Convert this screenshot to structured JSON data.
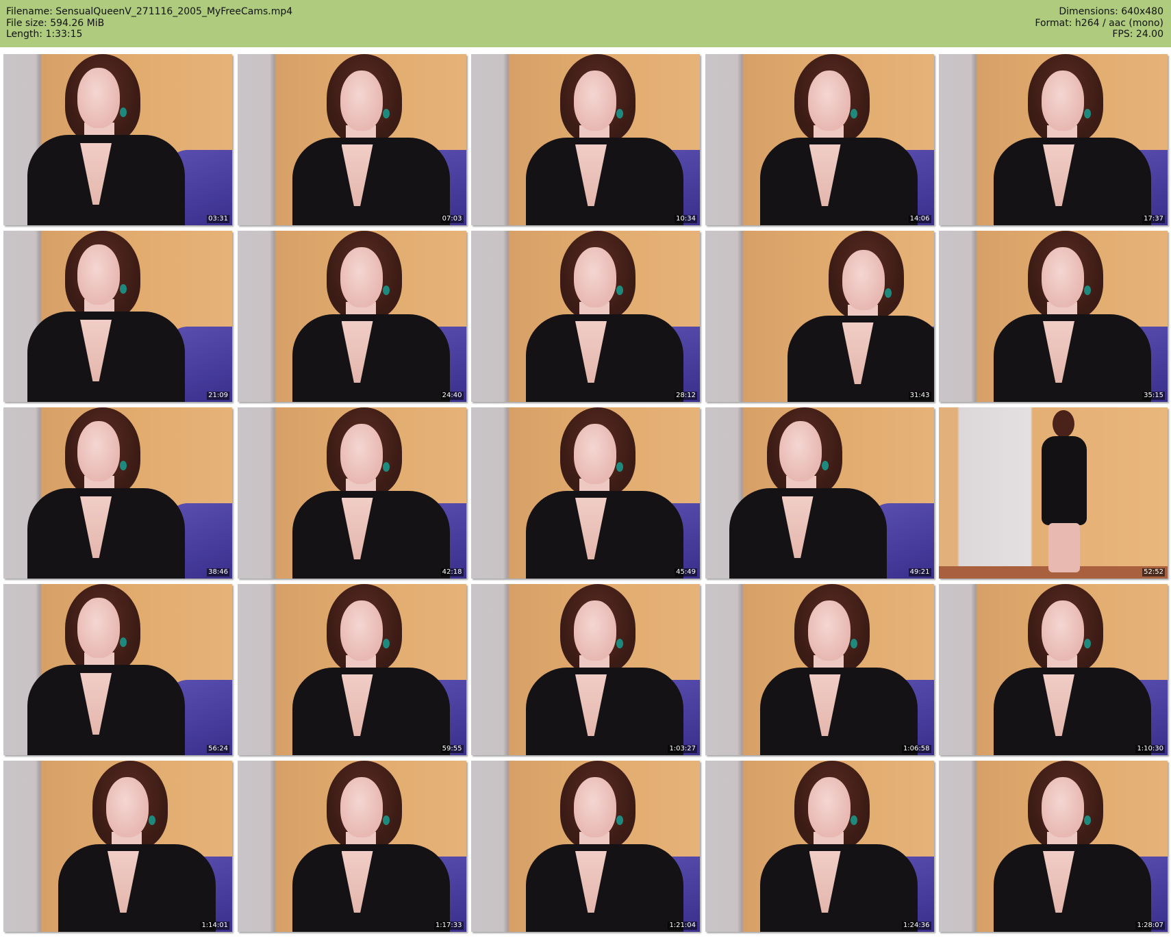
{
  "header": {
    "filename": "Filename: SensualQueenV_271116_2005_MyFreeCams.mp4",
    "filesize": "File size: 594.26 MiB",
    "length": "Length: 1:33:15",
    "dimensions": "Dimensions: 640x480",
    "format": "Format: h264 / aac (mono)",
    "fps": "FPS: 24.00"
  },
  "colors": {
    "header_bg": "#aecb7e",
    "page_bg": "#ffffff"
  },
  "thumbnails": [
    {
      "time": "03:31"
    },
    {
      "time": "07:03"
    },
    {
      "time": "10:34"
    },
    {
      "time": "14:06"
    },
    {
      "time": "17:37"
    },
    {
      "time": "21:09"
    },
    {
      "time": "24:40"
    },
    {
      "time": "28:12"
    },
    {
      "time": "31:43"
    },
    {
      "time": "35:15"
    },
    {
      "time": "38:46"
    },
    {
      "time": "42:18"
    },
    {
      "time": "45:49"
    },
    {
      "time": "49:21"
    },
    {
      "time": "52:52"
    },
    {
      "time": "56:24"
    },
    {
      "time": "59:55"
    },
    {
      "time": "1:03:27"
    },
    {
      "time": "1:06:58"
    },
    {
      "time": "1:10:30"
    },
    {
      "time": "1:14:01"
    },
    {
      "time": "1:17:33"
    },
    {
      "time": "1:21:04"
    },
    {
      "time": "1:24:36"
    },
    {
      "time": "1:28:07"
    }
  ]
}
